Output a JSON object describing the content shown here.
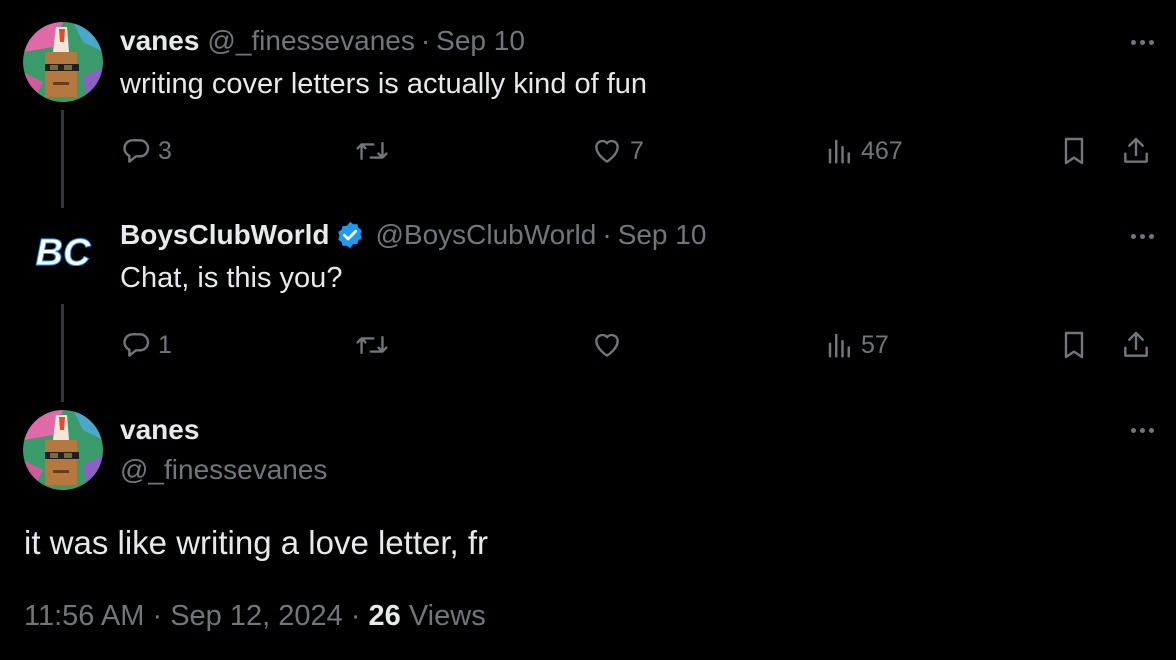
{
  "tweets": [
    {
      "display_name": "vanes",
      "handle": "@_finessevanes",
      "separator": "·",
      "date": "Sep 10",
      "text": "writing cover letters is actually kind of fun",
      "replies": "3",
      "reposts": "",
      "likes": "7",
      "views": "467"
    },
    {
      "display_name": "BoysClubWorld",
      "handle": "@BoysClubWorld",
      "separator": "·",
      "date": "Sep 10",
      "text": "Chat, is this you?",
      "replies": "1",
      "reposts": "",
      "likes": "",
      "views": "57",
      "avatar_text": "BC"
    }
  ],
  "main_tweet": {
    "display_name": "vanes",
    "handle": "@_finessevanes",
    "text": "it was like writing a love letter, fr",
    "time": "11:56 AM",
    "separator": "·",
    "date": "Sep 12, 2024",
    "views_count": "26",
    "views_label": "Views"
  },
  "colors": {
    "background": "#000000",
    "text": "#e7e9ea",
    "muted": "#71767b",
    "verified": "#1d9bf0",
    "thread_line": "#333639"
  },
  "icons": {
    "reply": "reply-icon",
    "repost": "repost-icon",
    "like": "heart-icon",
    "views": "views-icon",
    "bookmark": "bookmark-icon",
    "share": "share-icon",
    "more": "more-icon",
    "verified": "verified-badge-icon"
  }
}
